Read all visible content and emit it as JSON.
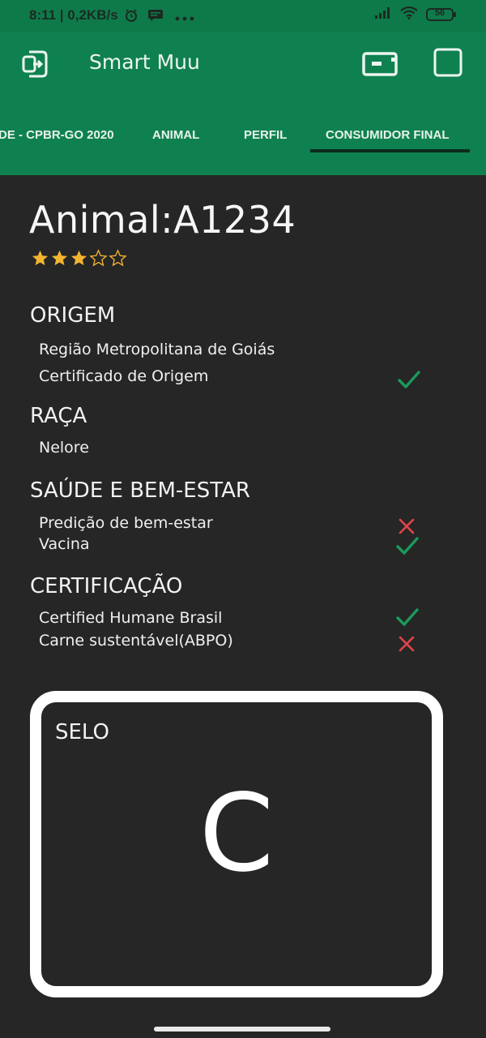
{
  "status_bar": {
    "time": "8:11 | 0,2KB/s",
    "battery": "56"
  },
  "app_bar": {
    "title": "Smart Muu"
  },
  "tabs": [
    {
      "label": "DE - CPBR-GO 2020"
    },
    {
      "label": "ANIMAL"
    },
    {
      "label": "PERFIL"
    },
    {
      "label": "CONSUMIDOR FINAL"
    }
  ],
  "animal": {
    "title": "Animal:A1234",
    "rating": 3,
    "rating_max": 5
  },
  "sections": {
    "origem": {
      "title": "ORIGEM",
      "items": [
        {
          "label": "Região Metropolitana de Goiás"
        },
        {
          "label": "Certificado de Origem",
          "status": "check"
        }
      ]
    },
    "raca": {
      "title": "RAÇA",
      "items": [
        {
          "label": "Nelore"
        }
      ]
    },
    "saude": {
      "title": "SAÚDE E BEM-ESTAR",
      "items": [
        {
          "label": "Predição de bem-estar",
          "status": "cross"
        },
        {
          "label": "Vacina",
          "status": "check"
        }
      ]
    },
    "certificacao": {
      "title": "CERTIFICAÇÃO",
      "items": [
        {
          "label": "Certified Humane Brasil",
          "status": "check"
        },
        {
          "label": "Carne sustentável(ABPO)",
          "status": "cross"
        }
      ]
    }
  },
  "seal": {
    "label": "SELO",
    "grade": "C"
  },
  "colors": {
    "header_green": "#0f8150",
    "check_green": "#1a9a5c",
    "cross_red": "#e0444a",
    "star_gold": "#f2b431",
    "background": "#262626"
  }
}
